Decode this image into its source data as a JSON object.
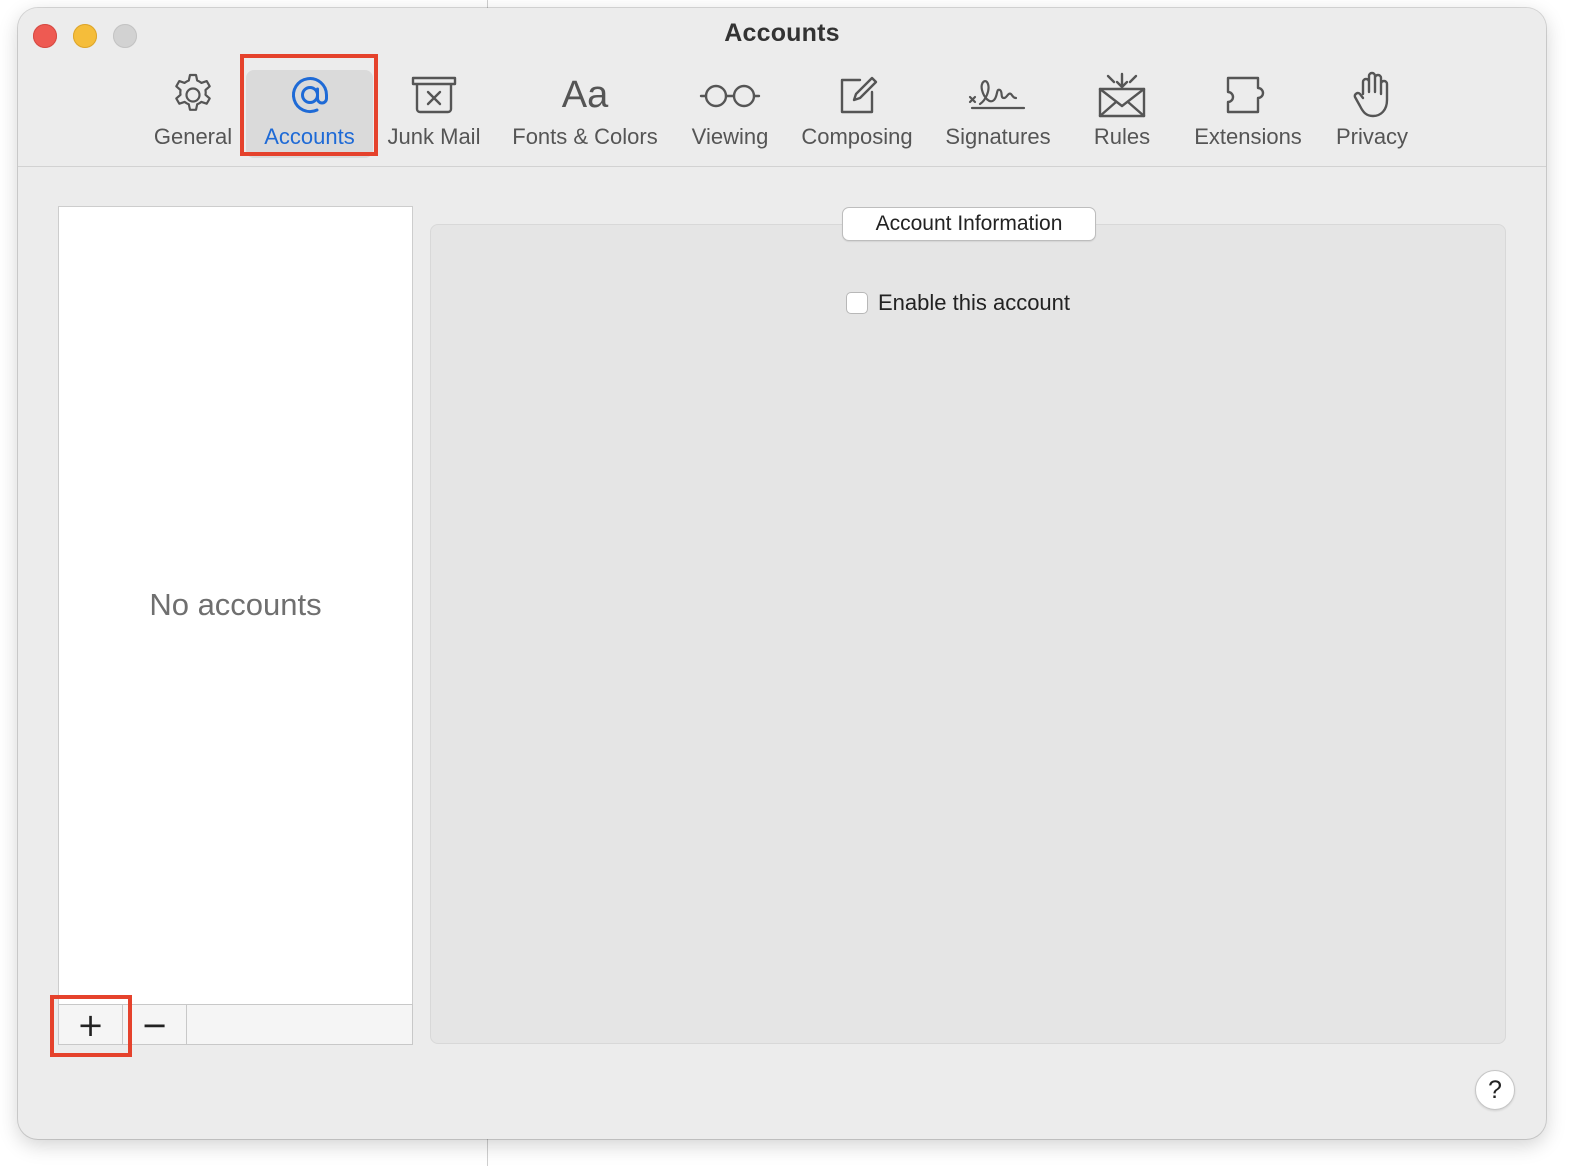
{
  "window": {
    "title": "Accounts"
  },
  "toolbar": {
    "tabs": [
      {
        "label": "General",
        "icon": "gear-icon",
        "selected": false
      },
      {
        "label": "Accounts",
        "icon": "at-sign-icon",
        "selected": true
      },
      {
        "label": "Junk Mail",
        "icon": "junk-bin-icon",
        "selected": false
      },
      {
        "label": "Fonts & Colors",
        "icon": "font-aa-icon",
        "selected": false
      },
      {
        "label": "Viewing",
        "icon": "glasses-icon",
        "selected": false
      },
      {
        "label": "Composing",
        "icon": "compose-pencil-icon",
        "selected": false
      },
      {
        "label": "Signatures",
        "icon": "signature-icon",
        "selected": false
      },
      {
        "label": "Rules",
        "icon": "envelope-rules-icon",
        "selected": false
      },
      {
        "label": "Extensions",
        "icon": "puzzle-piece-icon",
        "selected": false
      },
      {
        "label": "Privacy",
        "icon": "hand-icon",
        "selected": false
      }
    ],
    "icon_glyph": "Aa"
  },
  "accounts_list": {
    "empty_text": "No accounts",
    "add_label": "+",
    "remove_label": "−"
  },
  "account_info": {
    "tab_label": "Account Information",
    "enable_label": "Enable this account",
    "enable_checked": false
  },
  "help": {
    "label": "?"
  },
  "colors": {
    "selected_accent": "#1e6ad6",
    "highlight": "#e5422c",
    "close": "#ee5a52",
    "minimize": "#f5bd3a"
  }
}
